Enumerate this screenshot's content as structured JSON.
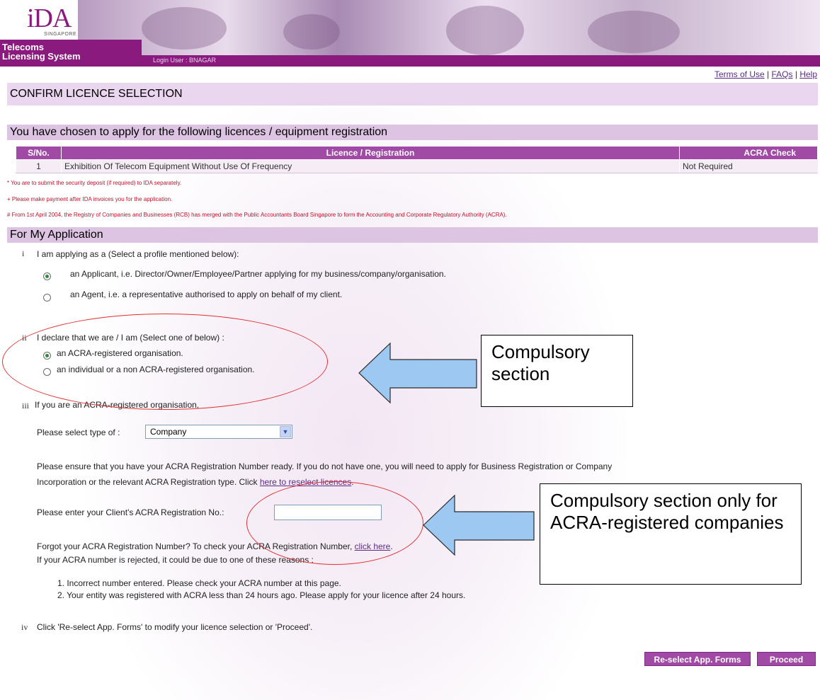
{
  "header": {
    "logo_text": "iDA",
    "logo_sub": "SINGAPORE",
    "system_name_line1": "Telecoms",
    "system_name_line2": "Licensing System",
    "login_label": "Login User : BNAGAR"
  },
  "top_links": {
    "terms": "Terms of Use",
    "faqs": "FAQs",
    "help": "Help",
    "separator": "|"
  },
  "page_title": "CONFIRM LICENCE SELECTION",
  "licences_section": {
    "heading": "You have chosen to apply for the following licences / equipment registration",
    "columns": [
      "S/No.",
      "Licence / Registration",
      "ACRA Check"
    ],
    "rows": [
      {
        "sno": "1",
        "licence": "Exhibition Of Telecom Equipment Without Use Of Frequency",
        "acra": "Not Required"
      }
    ]
  },
  "notes": [
    "* You are to submit the security deposit (if required) to IDA separately.",
    "+ Please make payment after IDA invoices you for the application.",
    "# From 1st April 2004, the Registry of Companies and Businesses (RCB) has merged with the Public Accountants Board Singapore to form the Accounting and Corporate Regulatory Authority (ACRA)."
  ],
  "application": {
    "heading": "For My Application",
    "q1": {
      "numeral": "i",
      "text": "I am applying as a (Select a profile mentioned below):",
      "options": [
        {
          "label": "an Applicant, i.e. Director/Owner/Employee/Partner applying for my business/company/organisation.",
          "selected": true
        },
        {
          "label": "an Agent, i.e. a representative authorised to apply on behalf of my client.",
          "selected": false
        }
      ]
    },
    "q2": {
      "numeral": "ii",
      "text": "I declare that we are / I am (Select one of below) :",
      "options": [
        {
          "label": "an ACRA-registered organisation.",
          "selected": true
        },
        {
          "label": "an individual or a non ACRA-registered organisation.",
          "selected": false
        }
      ]
    },
    "q3": {
      "numeral": "iii",
      "text": "If you are an ACRA-registered organisation,",
      "select_label": "Please select type of :",
      "select_value": "Company",
      "ensure_text_1": "Please ensure that you have your ACRA Registration Number ready. If you do not have one, you will need to apply for Business Registration or Company",
      "ensure_text_2": "Incorporation or the relevant ACRA Registration type. Click",
      "reselect_link": "here to reselect licences",
      "ensure_text_end": ".",
      "reg_label": "Please enter your Client's ACRA Registration No.:",
      "reg_value": "",
      "forgot_text": "Forgot your ACRA Registration Number? To check your ACRA Registration Number,",
      "forgot_link": "click here",
      "forgot_end": ".",
      "rejected_text": "If your ACRA number is rejected, it could be due to one of these reasons :",
      "reasons": [
        "1.  Incorrect number entered. Please check your ACRA number at this page.",
        "2.  Your entity was registered with ACRA less than 24 hours ago. Please apply for your licence after 24 hours."
      ]
    },
    "q4": {
      "numeral": "iv",
      "text": "Click 'Re-select App. Forms' to modify your licence selection or 'Proceed'."
    }
  },
  "buttons": {
    "reselect": "Re-select App. Forms",
    "proceed": "Proceed"
  },
  "annotations": {
    "callout1": "Compulsory section",
    "callout2": "Compulsory section only for ACRA-registered companies",
    "arrow_color": "#9cc8f2",
    "ellipse_color": "#e23030"
  }
}
